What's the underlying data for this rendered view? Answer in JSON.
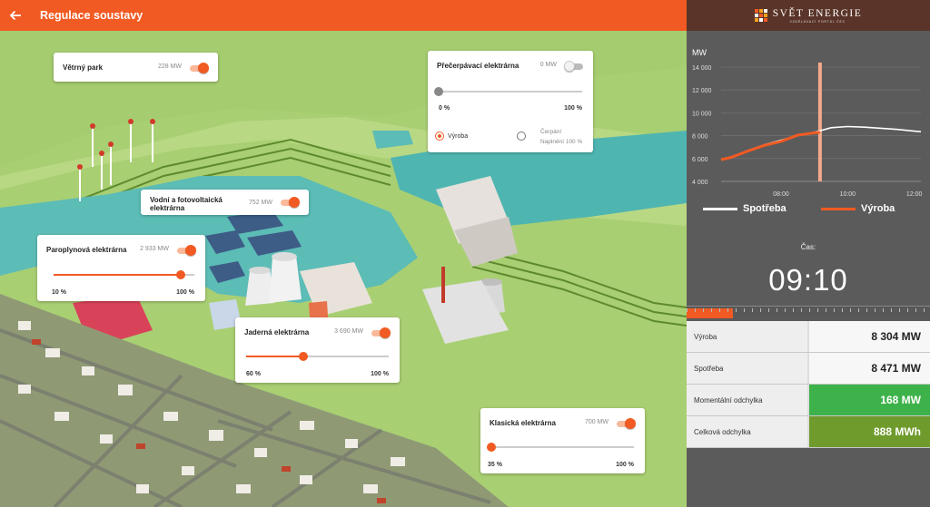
{
  "header": {
    "title": "Regulace soustavy",
    "back_icon": "arrow-left-icon"
  },
  "brand": {
    "name": "SVĚT ENERGIE",
    "tagline": "VZDĚLÁVACÍ PORTÁL ČEZ"
  },
  "plants": {
    "wind": {
      "name": "Větrný park",
      "mw": "228 MW",
      "on": true
    },
    "pumped": {
      "name": "Přečerpávací elektrárna",
      "mw": "0 MW",
      "on": false,
      "min": "0 %",
      "max": "100 %",
      "level": 0,
      "opt_gen": "Výroba",
      "opt_pump": "Čerpání",
      "fill_label": "Naplnění 100 %",
      "selected": "Výroba"
    },
    "hydro_pv": {
      "name1": "Vodní a fotovoltaická",
      "name2": "elektrárna",
      "mw": "752 MW",
      "on": true
    },
    "gas": {
      "name": "Paroplynová elektrárna",
      "mw": "2 933 MW",
      "on": true,
      "min": "10 %",
      "max": "100 %",
      "level": 0.9
    },
    "nuclear": {
      "name": "Jaderná elektrárna",
      "mw": "3 690 MW",
      "on": true,
      "min": "60 %",
      "max": "100 %",
      "level": 0.4
    },
    "classic": {
      "name": "Klasická elektrárna",
      "mw": "700 MW",
      "on": true,
      "min": "35 %",
      "max": "100 %",
      "level": 0
    }
  },
  "chart_data": {
    "type": "line",
    "ylabel": "MW",
    "yticks": [
      "14 000",
      "12 000",
      "10 000",
      "8 000",
      "6 000",
      "4 000"
    ],
    "ylim": [
      4000,
      14000
    ],
    "xticks": [
      "08:00",
      "10:00",
      "12:00"
    ],
    "xlim": [
      6.2,
      12.2
    ],
    "current_time": 9.17,
    "series": [
      {
        "name": "Spotřeba",
        "color": "#ffffff",
        "x": [
          6.2,
          6.5,
          7,
          7.5,
          8,
          8.5,
          9,
          9.2,
          9.5,
          10,
          10.5,
          11,
          11.5,
          12,
          12.2
        ],
        "y": [
          5900,
          6100,
          6700,
          7200,
          7600,
          8000,
          8300,
          8450,
          8700,
          8800,
          8750,
          8650,
          8550,
          8400,
          8350
        ]
      },
      {
        "name": "Výroba",
        "color": "#f15a22",
        "x": [
          6.2,
          6.5,
          7,
          7.5,
          8,
          8.5,
          9,
          9.17
        ],
        "y": [
          5900,
          6100,
          6650,
          7150,
          7500,
          8050,
          8250,
          8304
        ]
      }
    ],
    "legend": "bottom"
  },
  "time": {
    "label": "Čas:",
    "value": "09:10",
    "progress": 0.19
  },
  "stats": [
    {
      "label": "Výroba",
      "value": "8 304 MW"
    },
    {
      "label": "Spotřeba",
      "value": "8 471 MW"
    },
    {
      "label": "Momentální odchylka",
      "value": "168 MW"
    },
    {
      "label": "Celková odchylka",
      "value": "888 MWh"
    }
  ]
}
